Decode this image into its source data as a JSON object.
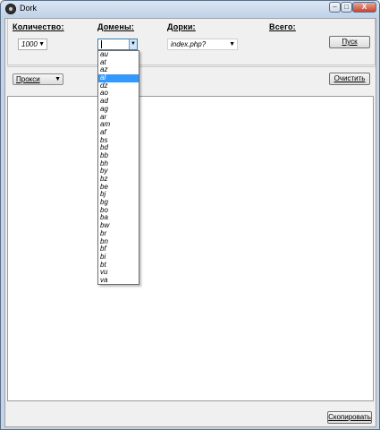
{
  "window": {
    "title": "Dork",
    "controls": {
      "minimize": "–",
      "maximize": "□",
      "close": "X"
    }
  },
  "top": {
    "count_label": "Количество:",
    "count_value": "1000",
    "domains_label": "Домены:",
    "domains_value": "",
    "dorks_label": "Дорки:",
    "dorks_value": "index.php?",
    "total_label": "Всего:",
    "start_button": "Пуск"
  },
  "toolbar": {
    "proxy_label": "Прокси",
    "clear_button": "Очистить"
  },
  "footer": {
    "copy_button": "Скопировать"
  },
  "domains_dropdown": {
    "selected_index": 3,
    "options": [
      "au",
      "at",
      "az",
      "al",
      "dz",
      "ao",
      "ad",
      "ag",
      "ar",
      "am",
      "af",
      "bs",
      "bd",
      "bb",
      "bh",
      "by",
      "bz",
      "be",
      "bj",
      "bg",
      "bo",
      "ba",
      "bw",
      "br",
      "bn",
      "bf",
      "bi",
      "bt",
      "vu",
      "va"
    ]
  },
  "icons": {
    "dropdown_arrow": "▼"
  },
  "colors": {
    "selection": "#3399ff",
    "titlebar": "#c4d4e6"
  }
}
